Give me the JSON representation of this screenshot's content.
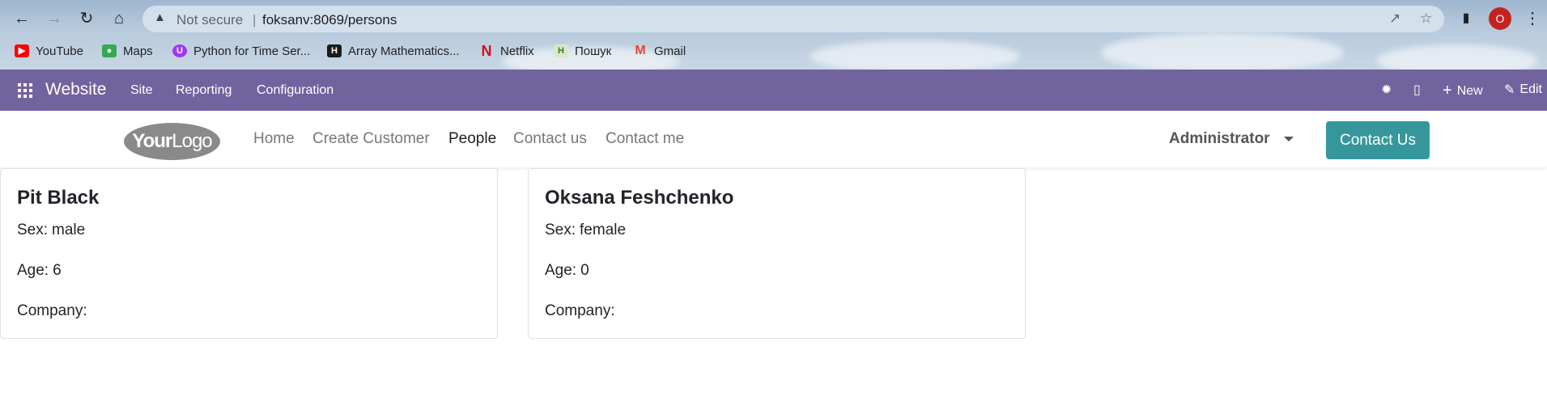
{
  "browser": {
    "security_label": "Not secure",
    "url": "foksanv:8069/persons",
    "profile_initial": "O",
    "bookmarks": [
      {
        "label": "YouTube",
        "icon": "youtube-icon",
        "color": "#ff0000"
      },
      {
        "label": "Maps",
        "icon": "maps-icon",
        "color": "#34a853"
      },
      {
        "label": "Python for Time Ser...",
        "icon": "udemy-icon",
        "color": "#a435f0"
      },
      {
        "label": "Array Mathematics...",
        "icon": "hackerrank-icon",
        "color": "#1ba94c"
      },
      {
        "label": "Netflix",
        "icon": "netflix-icon",
        "color": "#e50914"
      },
      {
        "label": "Пошук",
        "icon": "search-h-icon",
        "color": "#2e7d32"
      },
      {
        "label": "Gmail",
        "icon": "gmail-icon",
        "color": "#ea4335"
      }
    ]
  },
  "odoo_bar": {
    "app_name": "Website",
    "menus": [
      "Site",
      "Reporting",
      "Configuration"
    ],
    "new_label": "New",
    "edit_label": "Edit",
    "color": "#71639e"
  },
  "site_header": {
    "logo_your": "Your",
    "logo_logo": "Logo",
    "nav": [
      {
        "label": "Home",
        "active": false
      },
      {
        "label": "Create Customer",
        "active": false
      },
      {
        "label": "People",
        "active": true
      },
      {
        "label": "Contact us",
        "active": false
      },
      {
        "label": "Contact me",
        "active": false
      }
    ],
    "user": "Administrator",
    "cta": "Contact Us",
    "cta_color": "#35979c"
  },
  "persons": [
    {
      "name": "Pit Black",
      "sex_label": "Sex:",
      "sex": "male",
      "age_label": "Age:",
      "age": "6",
      "company_label": "Company:",
      "company": ""
    },
    {
      "name": "Oksana Feshchenko",
      "sex_label": "Sex:",
      "sex": "female",
      "age_label": "Age:",
      "age": "0",
      "company_label": "Company:",
      "company": ""
    }
  ]
}
